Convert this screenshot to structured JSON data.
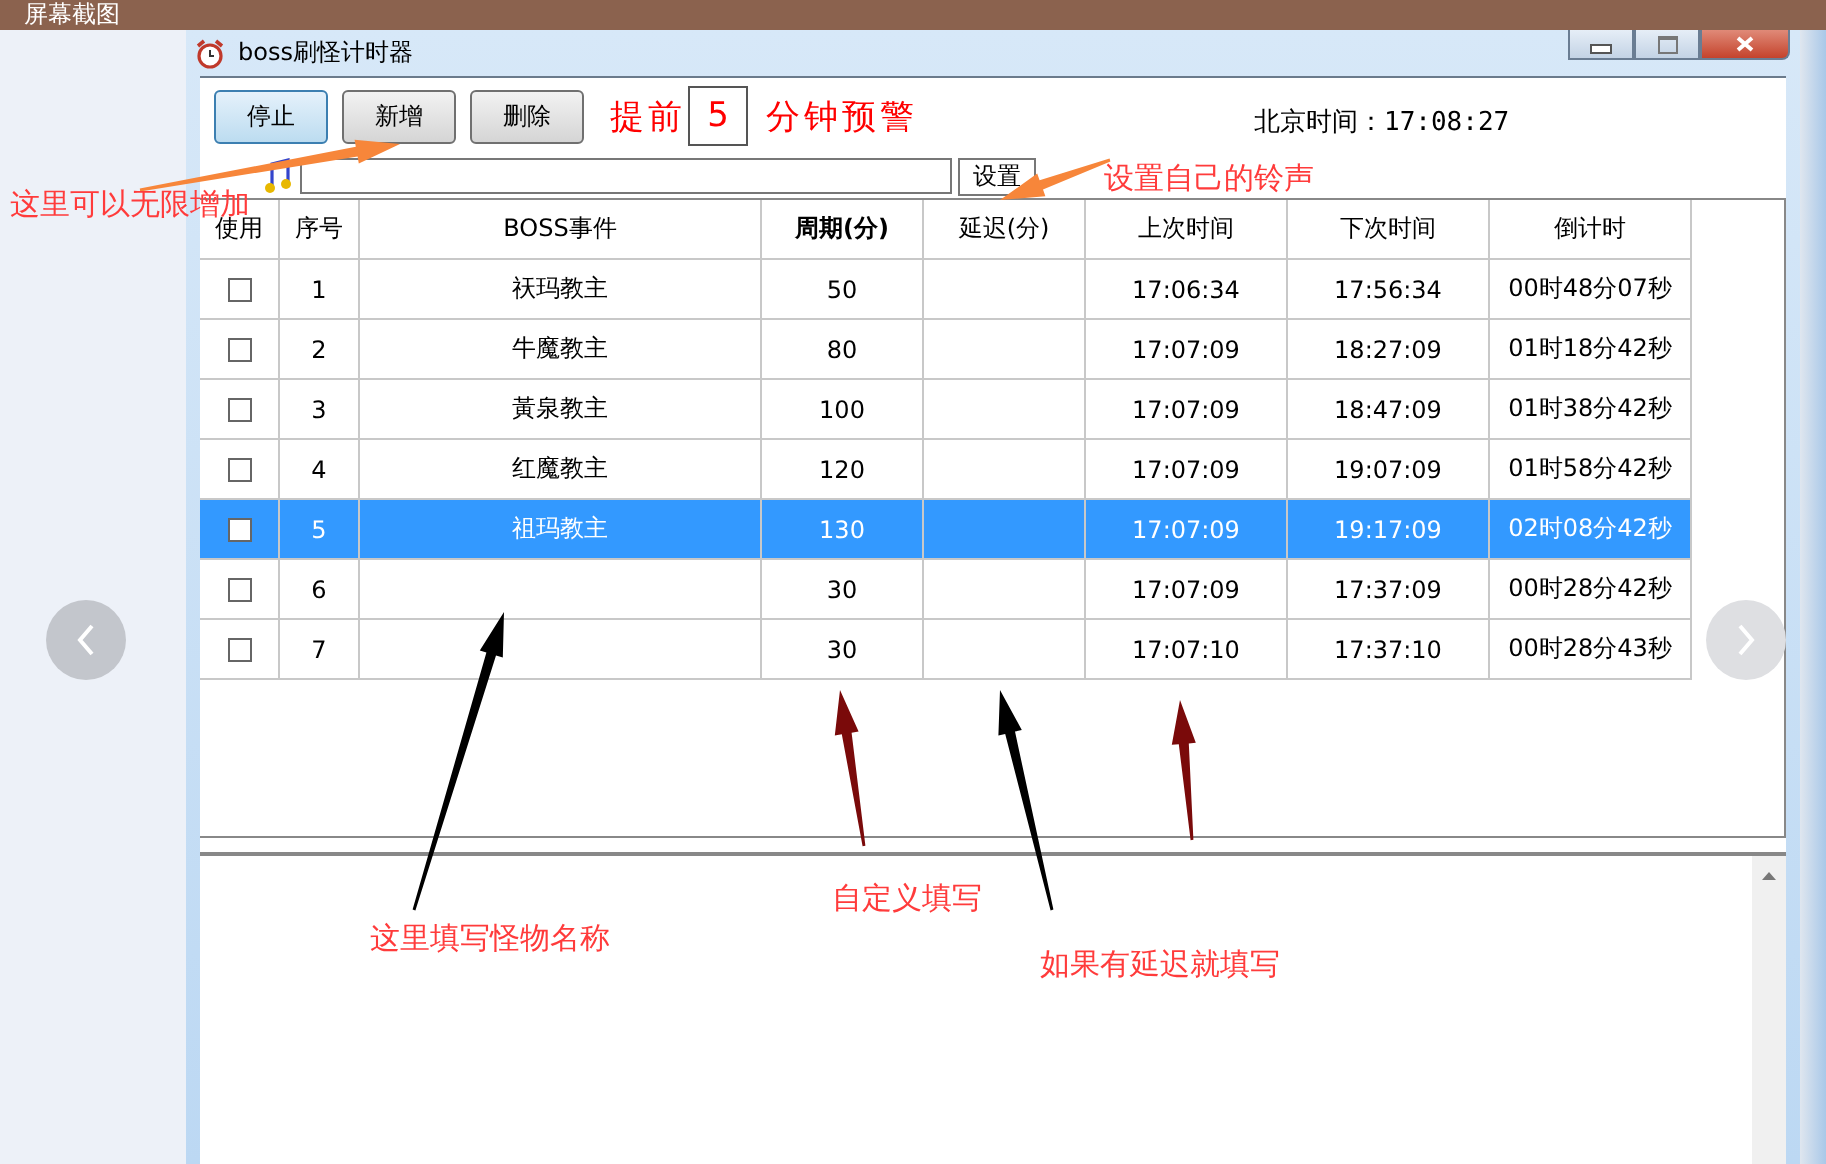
{
  "capture_bar": {
    "title": "屏幕截图"
  },
  "window": {
    "title": "boss刷怪计时器"
  },
  "toolbar": {
    "buttons": [
      "停止",
      "新增",
      "删除"
    ],
    "advance_label": "提前",
    "advance_minutes": "5",
    "warning_label": "分钟预警",
    "clock": "北京时间：17:08:27"
  },
  "ringtone": {
    "set_button": "设置"
  },
  "table": {
    "columns": [
      {
        "label": "使用",
        "bold": false
      },
      {
        "label": "序号",
        "bold": false
      },
      {
        "label": "BOSS事件",
        "bold": false
      },
      {
        "label": "周期(分)",
        "bold": true
      },
      {
        "label": "延迟(分)",
        "bold": false
      },
      {
        "label": "上次时间",
        "bold": false
      },
      {
        "label": "下次时间",
        "bold": false
      },
      {
        "label": "倒计时",
        "bold": false
      }
    ],
    "rows": [
      {
        "checked": false,
        "selected": false,
        "index": "1",
        "event": "祆玛教主",
        "period": "50",
        "last": "17:06:34",
        "next": "17:56:34",
        "countdown": "00时48分07秒"
      },
      {
        "checked": false,
        "selected": false,
        "index": "2",
        "event": "牛魔教主",
        "period": "80",
        "last": "17:07:09",
        "next": "18:27:09",
        "countdown": "01时18分42秒"
      },
      {
        "checked": false,
        "selected": false,
        "index": "3",
        "event": "黃泉教主",
        "period": "100",
        "last": "17:07:09",
        "next": "18:47:09",
        "countdown": "01时38分42秒"
      },
      {
        "checked": false,
        "selected": false,
        "index": "4",
        "event": "红魔教主",
        "period": "120",
        "last": "17:07:09",
        "next": "19:07:09",
        "countdown": "01时58分42秒"
      },
      {
        "checked": false,
        "selected": true,
        "index": "5",
        "event": "祖玛教主",
        "period": "130",
        "last": "17:07:09",
        "next": "19:17:09",
        "countdown": "02时08分42秒"
      },
      {
        "checked": false,
        "selected": false,
        "index": "6",
        "period": "30",
        "last": "17:07:09",
        "next": "17:37:09",
        "countdown": "00时28分42秒"
      },
      {
        "checked": false,
        "selected": false,
        "index": "7",
        "period": "30",
        "last": "17:07:10",
        "next": "17:37:10",
        "countdown": "00时28分43秒"
      }
    ]
  },
  "annotations": [
    {
      "text": "这里可以无限增加"
    },
    {
      "text": "设置自己的铃声"
    },
    {
      "text": "这里填写怪物名称"
    },
    {
      "text": "自定义填写"
    },
    {
      "text": "如果有延迟就填写"
    }
  ]
}
